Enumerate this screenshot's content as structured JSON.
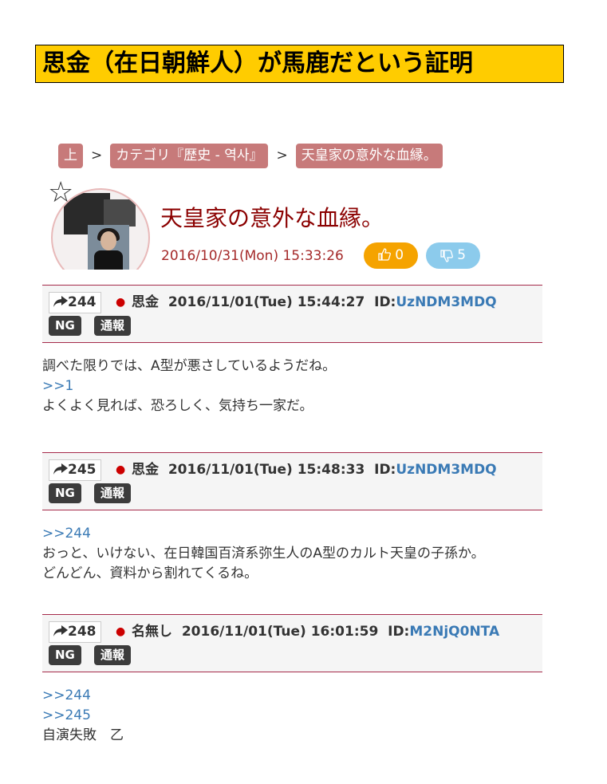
{
  "site": {
    "title": "思金（在日朝鮮人）が馬鹿だという証明"
  },
  "breadcrumb": {
    "items": [
      "上",
      "カテゴリ『歴史 - 역사』",
      "天皇家の意外な血縁。"
    ],
    "separator": ">"
  },
  "article": {
    "title": "天皇家の意外な血縁。",
    "date": "2016/10/31(Mon) 15:33:26",
    "star_icon": "☆",
    "good_votes": "0",
    "bad_votes": "5"
  },
  "posts": [
    {
      "number": "244",
      "author": "思金",
      "datetime": "2016/11/01(Tue) 15:44:27",
      "id_label": "ID:",
      "id": "UzNDM3MDQ",
      "ng_label": "NG",
      "report_label": "通報",
      "anchors": [
        "",
        ">>1"
      ],
      "lines": [
        "調べた限りでは、A型が悪さしているようだね。",
        "よくよく見れば、恐ろしく、気持ち一家だ。"
      ]
    },
    {
      "number": "245",
      "author": "思金",
      "datetime": "2016/11/01(Tue) 15:48:33",
      "id_label": "ID:",
      "id": "UzNDM3MDQ",
      "ng_label": "NG",
      "report_label": "通報",
      "anchors": [
        ">>244"
      ],
      "lines": [
        "おっと、いけない、在日韓国百済系弥生人のA型のカルト天皇の子孫か。",
        "どんどん、資料から割れてくるね。"
      ]
    },
    {
      "number": "248",
      "author": "名無し",
      "datetime": "2016/11/01(Tue) 16:01:59",
      "id_label": "ID:",
      "id": "M2NjQ0NTA",
      "ng_label": "NG",
      "report_label": "通報",
      "anchors": [
        ">>244",
        ">>245"
      ],
      "lines": [
        "自演失敗　乙"
      ]
    }
  ],
  "colors": {
    "title_bg": "#ffcc00",
    "crumb_bg": "#c77a7a",
    "article_title": "#8b0000",
    "good_vote": "#f5a300",
    "bad_vote": "#8ccbec",
    "id_link": "#3a7ab5",
    "anchor_link": "#3a7ab5"
  },
  "icons": {
    "share": "share-arrow-icon",
    "thumbs_up": "thumbs-up-icon",
    "thumbs_down": "thumbs-down-icon",
    "bullet": "red-dot-icon",
    "star": "star-outline-icon"
  }
}
